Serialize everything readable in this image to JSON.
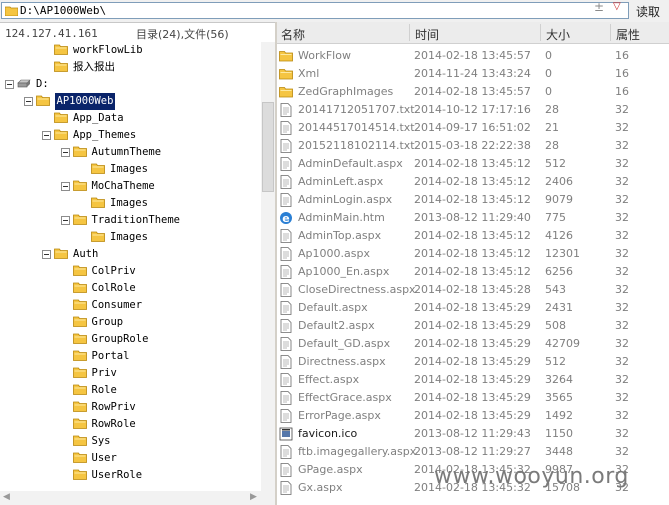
{
  "path_bar": {
    "path": "D:\\AP1000Web\\",
    "read_button": "读取",
    "fav_icon": "star-icon",
    "drop_icon": "chevron-down-icon"
  },
  "status": {
    "ip": "124.127.41.161",
    "counts": "目录(24),文件(56)"
  },
  "tree": [
    {
      "label": "workFlowLib",
      "depth": 2,
      "toggle": false
    },
    {
      "label": "报入报出",
      "depth": 2,
      "toggle": false
    },
    {
      "label": "D:",
      "depth": 0,
      "toggle": true,
      "drive": true
    },
    {
      "label": "AP1000Web",
      "depth": 1,
      "toggle": true,
      "selected": true
    },
    {
      "label": "App_Data",
      "depth": 2,
      "toggle": false
    },
    {
      "label": "App_Themes",
      "depth": 2,
      "toggle": true
    },
    {
      "label": "AutumnTheme",
      "depth": 3,
      "toggle": true
    },
    {
      "label": "Images",
      "depth": 4,
      "toggle": false
    },
    {
      "label": "MoChaTheme",
      "depth": 3,
      "toggle": true
    },
    {
      "label": "Images",
      "depth": 4,
      "toggle": false
    },
    {
      "label": "TraditionTheme",
      "depth": 3,
      "toggle": true
    },
    {
      "label": "Images",
      "depth": 4,
      "toggle": false
    },
    {
      "label": "Auth",
      "depth": 2,
      "toggle": true
    },
    {
      "label": "ColPriv",
      "depth": 3,
      "toggle": false
    },
    {
      "label": "ColRole",
      "depth": 3,
      "toggle": false
    },
    {
      "label": "Consumer",
      "depth": 3,
      "toggle": false
    },
    {
      "label": "Group",
      "depth": 3,
      "toggle": false
    },
    {
      "label": "GroupRole",
      "depth": 3,
      "toggle": false
    },
    {
      "label": "Portal",
      "depth": 3,
      "toggle": false
    },
    {
      "label": "Priv",
      "depth": 3,
      "toggle": false
    },
    {
      "label": "Role",
      "depth": 3,
      "toggle": false
    },
    {
      "label": "RowPriv",
      "depth": 3,
      "toggle": false
    },
    {
      "label": "RowRole",
      "depth": 3,
      "toggle": false
    },
    {
      "label": "Sys",
      "depth": 3,
      "toggle": false
    },
    {
      "label": "User",
      "depth": 3,
      "toggle": false
    },
    {
      "label": "UserRole",
      "depth": 3,
      "toggle": false
    }
  ],
  "list_headers": {
    "name": "名称",
    "time": "时间",
    "size": "大小",
    "attr": "属性"
  },
  "files": [
    {
      "name": "WorkFlow",
      "time": "2014-02-18 13:45:57",
      "size": "0",
      "attr": "16",
      "icon": "folder-icon"
    },
    {
      "name": "Xml",
      "time": "2014-11-24 13:43:24",
      "size": "0",
      "attr": "16",
      "icon": "folder-icon"
    },
    {
      "name": "ZedGraphImages",
      "time": "2014-02-18 13:45:57",
      "size": "0",
      "attr": "16",
      "icon": "folder-icon"
    },
    {
      "name": "20141712051707.txt",
      "time": "2014-10-12 17:17:16",
      "size": "28",
      "attr": "32",
      "icon": "text-file-icon"
    },
    {
      "name": "20144517014514.txt",
      "time": "2014-09-17 16:51:02",
      "size": "21",
      "attr": "32",
      "icon": "text-file-icon"
    },
    {
      "name": "20152118102114.txt",
      "time": "2015-03-18 22:22:38",
      "size": "28",
      "attr": "32",
      "icon": "text-file-icon"
    },
    {
      "name": "AdminDefault.aspx",
      "time": "2014-02-18 13:45:12",
      "size": "512",
      "attr": "32",
      "icon": "document-icon"
    },
    {
      "name": "AdminLeft.aspx",
      "time": "2014-02-18 13:45:12",
      "size": "2406",
      "attr": "32",
      "icon": "document-icon"
    },
    {
      "name": "AdminLogin.aspx",
      "time": "2014-02-18 13:45:12",
      "size": "9079",
      "attr": "32",
      "icon": "document-icon"
    },
    {
      "name": "AdminMain.htm",
      "time": "2013-08-12 11:29:40",
      "size": "775",
      "attr": "32",
      "icon": "ie-icon"
    },
    {
      "name": "AdminTop.aspx",
      "time": "2014-02-18 13:45:12",
      "size": "4126",
      "attr": "32",
      "icon": "document-icon"
    },
    {
      "name": "Ap1000.aspx",
      "time": "2014-02-18 13:45:12",
      "size": "12301",
      "attr": "32",
      "icon": "document-icon"
    },
    {
      "name": "Ap1000_En.aspx",
      "time": "2014-02-18 13:45:12",
      "size": "6256",
      "attr": "32",
      "icon": "document-icon"
    },
    {
      "name": "CloseDirectness.aspx",
      "time": "2014-02-18 13:45:28",
      "size": "543",
      "attr": "32",
      "icon": "document-icon"
    },
    {
      "name": "Default.aspx",
      "time": "2014-02-18 13:45:29",
      "size": "2431",
      "attr": "32",
      "icon": "document-icon"
    },
    {
      "name": "Default2.aspx",
      "time": "2014-02-18 13:45:29",
      "size": "508",
      "attr": "32",
      "icon": "document-icon"
    },
    {
      "name": "Default_GD.aspx",
      "time": "2014-02-18 13:45:29",
      "size": "42709",
      "attr": "32",
      "icon": "document-icon"
    },
    {
      "name": "Directness.aspx",
      "time": "2014-02-18 13:45:29",
      "size": "512",
      "attr": "32",
      "icon": "document-icon"
    },
    {
      "name": "Effect.aspx",
      "time": "2014-02-18 13:45:29",
      "size": "3264",
      "attr": "32",
      "icon": "document-icon"
    },
    {
      "name": "EffectGrace.aspx",
      "time": "2014-02-18 13:45:29",
      "size": "3565",
      "attr": "32",
      "icon": "document-icon"
    },
    {
      "name": "ErrorPage.aspx",
      "time": "2014-02-18 13:45:29",
      "size": "1492",
      "attr": "32",
      "icon": "document-icon"
    },
    {
      "name": "favicon.ico",
      "time": "2013-08-12 11:29:43",
      "size": "1150",
      "attr": "32",
      "icon": "image-file-icon",
      "dark": true
    },
    {
      "name": "ftb.imagegallery.aspx",
      "time": "2013-08-12 11:29:27",
      "size": "3448",
      "attr": "32",
      "icon": "document-icon"
    },
    {
      "name": "GPage.aspx",
      "time": "2014-02-18 13:45:32",
      "size": "9987",
      "attr": "32",
      "icon": "document-icon"
    },
    {
      "name": "Gx.aspx",
      "time": "2014-02-18 13:45:32",
      "size": "15708",
      "attr": "32",
      "icon": "document-icon"
    }
  ],
  "watermark": "www.wooyun.org",
  "colors": {
    "selection": "#0a246a",
    "folder": "#f5c542",
    "file_text": "#7f7f7f",
    "ie_blue": "#2a7fd4"
  }
}
